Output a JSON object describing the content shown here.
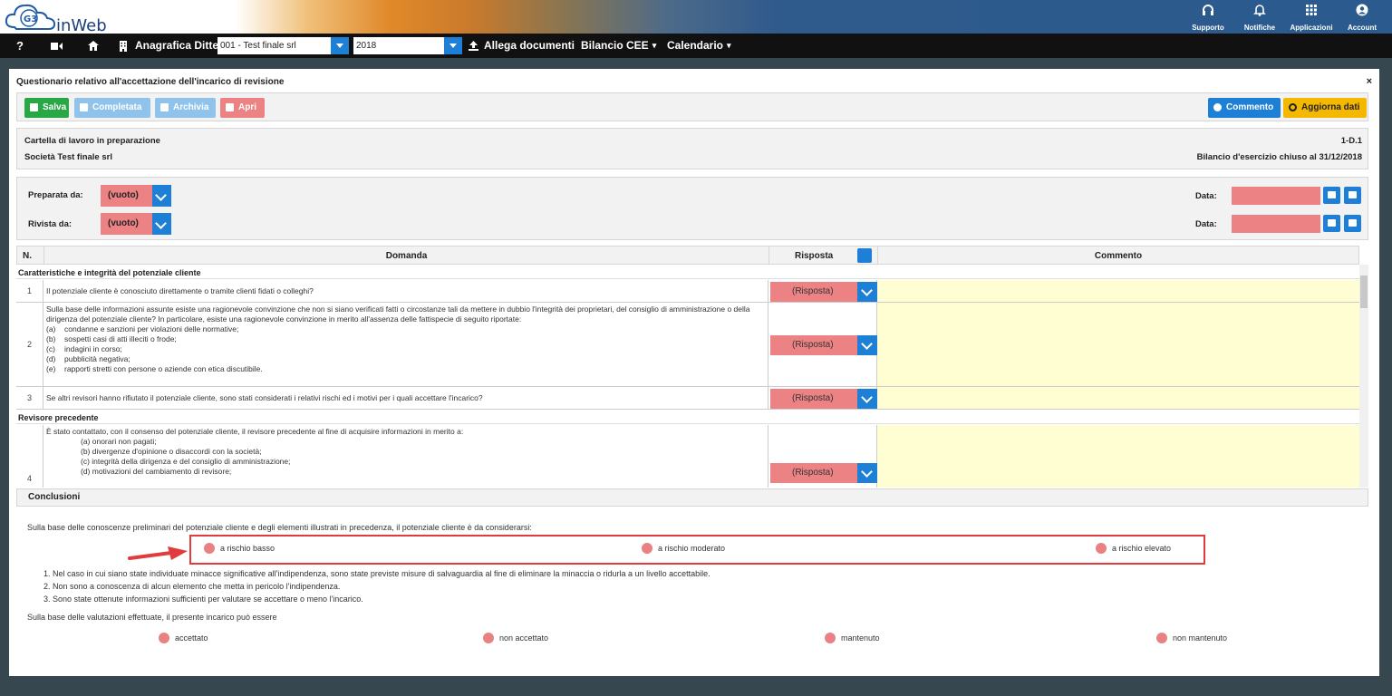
{
  "app": {
    "brand": "inWeb",
    "logo_text": "G3"
  },
  "top_icons": [
    {
      "label": "Supporto",
      "icon": "headset-icon"
    },
    {
      "label": "Notifiche",
      "icon": "bell-icon"
    },
    {
      "label": "Applicazioni",
      "icon": "grid-icon"
    },
    {
      "label": "Account",
      "icon": "user-icon"
    }
  ],
  "menubar": {
    "help": "?",
    "anagrafica": "Anagrafica Ditte",
    "company_select": "001 - Test finale srl",
    "year_select": "2018",
    "allega": "Allega documenti",
    "bilancio": "Bilancio CEE",
    "calendario": "Calendario"
  },
  "panel": {
    "title": "Questionario relativo all'accettazione dell'incarico di revisione",
    "close": "×",
    "buttons": {
      "salva": "Salva",
      "completata": "Completata",
      "archivia": "Archivia",
      "apri": "Apri",
      "commento": "Commento",
      "aggiorna": "Aggiorna dati"
    },
    "info": {
      "status": "Cartella di lavoro in preparazione",
      "code": "1-D.1",
      "company": "Società Test finale srl",
      "bilancio": "Bilancio d'esercizio chiuso al 31/12/2018"
    },
    "preparata_label": "Preparata da:",
    "rivista_label": "Rivista da:",
    "vuoto": "(vuoto)",
    "data_label": "Data:"
  },
  "table": {
    "headers": {
      "n": "N.",
      "domanda": "Domanda",
      "risposta": "Risposta",
      "commento": "Commento"
    },
    "section1": "Caratteristiche e integrità del potenziale cliente",
    "section2": "Revisore precedente",
    "response_placeholder": "(Risposta)",
    "rows": [
      {
        "n": "1",
        "text": "Il potenziale cliente è conosciuto direttamente o tramite clienti fidati o colleghi?"
      },
      {
        "n": "2",
        "text": "Sulla base delle informazioni assunte esiste una ragionevole convinzione che non si siano verificati fatti o circostanze tali da mettere in dubbio l'integrità dei proprietari, del consiglio di amministrazione o della dirigenza del potenziale cliente? In particolare, esiste una ragionevole convinzione in merito all'assenza delle fattispecie di seguito riportate:",
        "items": [
          {
            "k": "(a)",
            "t": "condanne e sanzioni per violazioni delle normative;"
          },
          {
            "k": "(b)",
            "t": "sospetti casi di atti illeciti o frode;"
          },
          {
            "k": "(c)",
            "t": "indagini in corso;"
          },
          {
            "k": "(d)",
            "t": "pubblicità negativa;"
          },
          {
            "k": "(e)",
            "t": "rapporti stretti con persone o aziende con etica discutibile."
          }
        ]
      },
      {
        "n": "3",
        "text": "Se altri revisori hanno rifiutato il potenziale cliente, sono stati considerati i relativi rischi ed i motivi per i quali accettare l'incarico?"
      },
      {
        "n": "4",
        "text": "È stato contattato, con il consenso del potenziale cliente, il revisore precedente al fine di acquisire informazioni in merito a:",
        "items": [
          "(a) onorari non pagati;",
          "(b) divergenze d'opinione o disaccordi con la società;",
          "(c) integrità della dirigenza e del consiglio di amministrazione;",
          "(d) motivazioni del cambiamento di revisore;"
        ]
      }
    ]
  },
  "conclusioni": {
    "title": "Conclusioni",
    "intro": "Sulla base delle conoscenze preliminari del potenziale cliente e degli elementi illustrati in precedenza, il potenziale cliente è da considerarsi:",
    "risk_options": [
      "a rischio basso",
      "a rischio moderato",
      "a rischio elevato"
    ],
    "notes": [
      "1. Nel caso in cui siano state individuate minacce significative all'indipendenza, sono state previste misure di salvaguardia al fine di eliminare la minaccia o ridurla a un livello accettabile.",
      "2. Non sono a conoscenza di alcun elemento che metta in pericolo l'indipendenza.",
      "3. Sono state ottenute informazioni sufficienti per valutare se accettare o meno l'incarico."
    ],
    "valutazioni": "Sulla base delle valutazioni effettuate, il presente incarico può essere",
    "outcome_options": [
      "accettato",
      "non accettato",
      "mantenuto",
      "non mantenuto"
    ]
  },
  "colors": {
    "accent": "#1e7fd6",
    "pink": "#ec8284",
    "yellow": "#fefed2",
    "highlight": "#e03c3c"
  }
}
